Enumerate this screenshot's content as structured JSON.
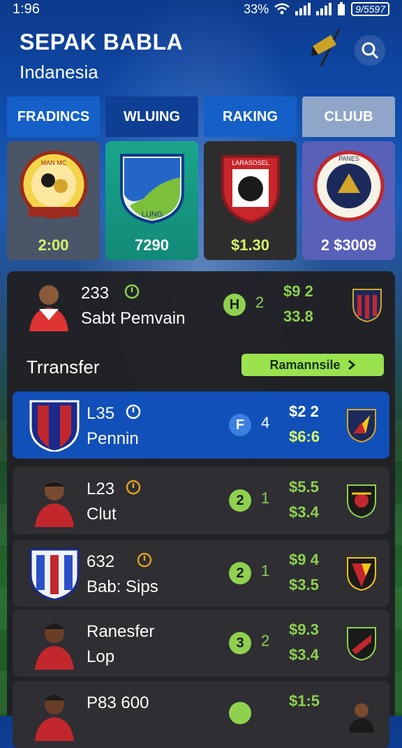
{
  "status": {
    "time": "1:96",
    "battery_pct": "33%",
    "battery_label": "9/5597"
  },
  "header": {
    "title": "SEPAK BABLA",
    "subtitle": "Indanesia"
  },
  "tabs": [
    {
      "label": "FRADINCS"
    },
    {
      "label": "WLUING"
    },
    {
      "label": "RAKING"
    },
    {
      "label": "CLUUB"
    }
  ],
  "cards": [
    {
      "value": "2:00",
      "crest_text": "MAN MC"
    },
    {
      "value": "7290",
      "crest_text": "LUNG"
    },
    {
      "value": "$1.30",
      "crest_text": "LARASOSEL"
    },
    {
      "value": "2 $3009",
      "crest_text": "PANES"
    }
  ],
  "players": [
    {
      "code": "233",
      "name": "Sabt Pemvain",
      "pill": "H",
      "count": "2",
      "price1": "$9 2",
      "price2": "33.8"
    },
    {
      "code": "L35",
      "name": "Pennin",
      "pill": "F",
      "count": "4",
      "price1": "$2 2",
      "price2": "$6:6"
    },
    {
      "code": "L23",
      "name": "Clut",
      "pill": "2",
      "count": "1",
      "price1": "$5.5",
      "price2": "$3.4"
    },
    {
      "code": "632",
      "name": "Bab: Sips",
      "pill": "2",
      "count": "1",
      "price1": "$9 4",
      "price2": "$3.5"
    },
    {
      "code": "",
      "name_line1": "Ranesfer",
      "name": "Lop",
      "pill": "3",
      "count": "2",
      "price1": "$9.3",
      "price2": "$3.4"
    },
    {
      "code": "P83  600",
      "name": "",
      "pill": "",
      "count": "",
      "price1": "$1:5",
      "price2": ""
    }
  ],
  "transfer": {
    "label": "Trransfer",
    "button": "Ramannsile"
  },
  "colors": {
    "accent_green": "#8fd14f",
    "highlight_blue": "#1150b8",
    "button_green": "#9be24f"
  }
}
